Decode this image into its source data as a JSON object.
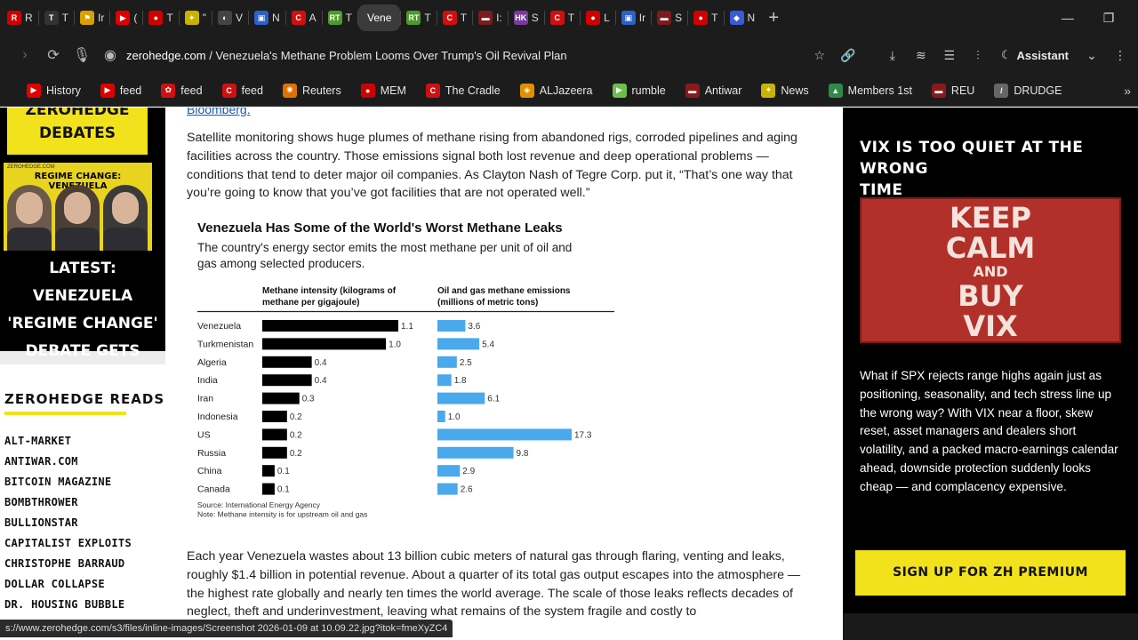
{
  "tabs": [
    {
      "letter": "R",
      "color": "#cc0000",
      "label": "R"
    },
    {
      "letter": "T",
      "color": "#333333",
      "label": "T"
    },
    {
      "letter": "⚑",
      "color": "#d8a000",
      "label": "Ir"
    },
    {
      "letter": "▶",
      "color": "#e00000",
      "label": "("
    },
    {
      "letter": "●",
      "color": "#d00000",
      "label": "T"
    },
    {
      "letter": "✦",
      "color": "#c8b400",
      "label": "\""
    },
    {
      "letter": "◐",
      "color": "#444444",
      "label": "V"
    },
    {
      "letter": "▣",
      "color": "#2a62c9",
      "label": "N"
    },
    {
      "letter": "C",
      "color": "#d01010",
      "label": "A"
    },
    {
      "letter": "RT",
      "color": "#4d9a2c",
      "label": "T"
    },
    {
      "letter": "",
      "color": "",
      "label": "Vene",
      "active": true
    },
    {
      "letter": "RT",
      "color": "#4d9a2c",
      "label": "T"
    },
    {
      "letter": "C",
      "color": "#d01010",
      "label": "T"
    },
    {
      "letter": "▬",
      "color": "#7a1c1c",
      "label": "I:"
    },
    {
      "letter": "HK",
      "color": "#7a3a9a",
      "label": "S"
    },
    {
      "letter": "C",
      "color": "#d01010",
      "label": "T"
    },
    {
      "letter": "●",
      "color": "#d00000",
      "label": "L"
    },
    {
      "letter": "▣",
      "color": "#2a62c9",
      "label": "Ir"
    },
    {
      "letter": "▬",
      "color": "#7a1c1c",
      "label": "S"
    },
    {
      "letter": "●",
      "color": "#d00000",
      "label": "T"
    },
    {
      "letter": "◆",
      "color": "#3b5bd6",
      "label": "N"
    }
  ],
  "address": {
    "host": "zerohedge.com",
    "rest": " / Venezuela's Methane Problem Looms Over Trump's Oil Revival Plan",
    "assistant": "Assistant"
  },
  "bookmarks": [
    {
      "label": "History",
      "color": "#e00000",
      "glyph": "▶"
    },
    {
      "label": "feed",
      "color": "#e00000",
      "glyph": "▶"
    },
    {
      "label": "feed",
      "color": "#d01010",
      "glyph": "✿"
    },
    {
      "label": "feed",
      "color": "#d01010",
      "glyph": "C"
    },
    {
      "label": "Reuters",
      "color": "#e07000",
      "glyph": "✺"
    },
    {
      "label": "MEM",
      "color": "#d00000",
      "glyph": "●"
    },
    {
      "label": "The Cradle",
      "color": "#d01010",
      "glyph": "C"
    },
    {
      "label": "ALJazeera",
      "color": "#e09000",
      "glyph": "◈"
    },
    {
      "label": "rumble",
      "color": "#6cc04a",
      "glyph": "▶"
    },
    {
      "label": "Antiwar",
      "color": "#8a1a1a",
      "glyph": "▬"
    },
    {
      "label": "News",
      "color": "#c8b400",
      "glyph": "✦"
    },
    {
      "label": "Members 1st",
      "color": "#2f8a4a",
      "glyph": "▲"
    },
    {
      "label": "REU",
      "color": "#8a1a1a",
      "glyph": "▬"
    },
    {
      "label": "DRUDGE",
      "color": "#666666",
      "glyph": "/"
    }
  ],
  "left": {
    "banner_line1": "ZEROHEDGE",
    "banner_line2": "DEBATES",
    "promo_tag": "ZEROHEDGE.COM",
    "promo_title": "REGIME CHANGE: VENEZUELA",
    "headline_lines": [
      "LATEST: VENEZUELA",
      "'REGIME CHANGE'",
      "DEBATE GETS FIERY"
    ],
    "reads_title": "ZEROHEDGE READS",
    "reads": [
      "ALT-MARKET",
      "ANTIWAR.COM",
      "BITCOIN MAGAZINE",
      "BOMBTHROWER",
      "BULLIONSTAR",
      "CAPITALIST EXPLOITS",
      "CHRISTOPHE BARRAUD",
      "DOLLAR COLLAPSE",
      "DR. HOUSING BUBBLE"
    ]
  },
  "article": {
    "link": "Bloomberg.",
    "para1": "Satellite monitoring shows huge plumes of methane rising from abandoned rigs, corroded pipelines and aging facilities across the country. Those emissions signal both lost revenue and deep operational problems — conditions that tend to deter major oil companies. As Clayton Nash of Tegre Corp. put it, “That’s one way that you’re going to know that you’ve got facilities that are not operated well.”",
    "para2": "Each year Venezuela wastes about 13 billion cubic meters of natural gas through flaring, venting and leaks, roughly $1.4 billion in potential revenue. About a quarter of its total gas output escapes into the atmosphere — the highest rate globally and nearly ten times the world average. The scale of those leaks reflects decades of neglect, theft and underinvestment, leaving what remains of the system fragile and costly to"
  },
  "chart_data": {
    "type": "bar",
    "title": "Venezuela Has Some of the World's Worst Methane Leaks",
    "subtitle_lines": [
      "The country's energy sector emits the most methane per unit of oil and",
      "gas among selected producers."
    ],
    "categories": [
      "Venezuela",
      "Turkmenistan",
      "Algeria",
      "India",
      "Iran",
      "Indonesia",
      "US",
      "Russia",
      "China",
      "Canada"
    ],
    "series": [
      {
        "name": "Methane intensity (kilograms of methane per gigajoule)",
        "header_lines": [
          "Methane intensity (kilograms of",
          "methane per gigajoule)"
        ],
        "values": [
          1.1,
          1.0,
          0.4,
          0.4,
          0.3,
          0.2,
          0.2,
          0.2,
          0.1,
          0.1
        ],
        "labels": [
          "1.1",
          "1.0",
          "0.4",
          "0.4",
          "0.3",
          "0.2",
          "0.2",
          "0.2",
          "0.1",
          "0.1"
        ],
        "color": "#000000"
      },
      {
        "name": "Oil and gas methane emissions (millions of metric tons)",
        "header_lines": [
          "Oil and gas methane emissions",
          "(millions of metric tons)"
        ],
        "values": [
          3.6,
          5.4,
          2.5,
          1.8,
          6.1,
          1.0,
          17.3,
          9.8,
          2.9,
          2.6
        ],
        "labels": [
          "3.6",
          "5.4",
          "2.5",
          "1.8",
          "6.1",
          "1.0",
          "17.3",
          "9.8",
          "2.9",
          "2.6"
        ],
        "color": "#4aa8ec"
      }
    ],
    "source_lines": [
      "Source: International Energy Agency",
      "Note: Methane intensity is for upstream oil and gas"
    ]
  },
  "right": {
    "title_lines": [
      "VIX IS TOO QUIET AT THE WRONG",
      "TIME"
    ],
    "poster": [
      "KEEP",
      "CALM",
      "AND",
      "BUY",
      "VIX"
    ],
    "body": "What if SPX rejects range highs again just as positioning, seasonality, and tech stress line up the wrong way? With VIX near a floor, skew reset, asset managers and dealers short volatility, and a packed macro-earnings calendar ahead, downside protection suddenly looks cheap — and complacency expensive.",
    "cta": "SIGN UP FOR ZH PREMIUM"
  },
  "status_url": "s://www.zerohedge.com/s3/files/inline-images/Screenshot 2026-01-09 at 10.09.22.jpg?itok=fmeXyZC4"
}
